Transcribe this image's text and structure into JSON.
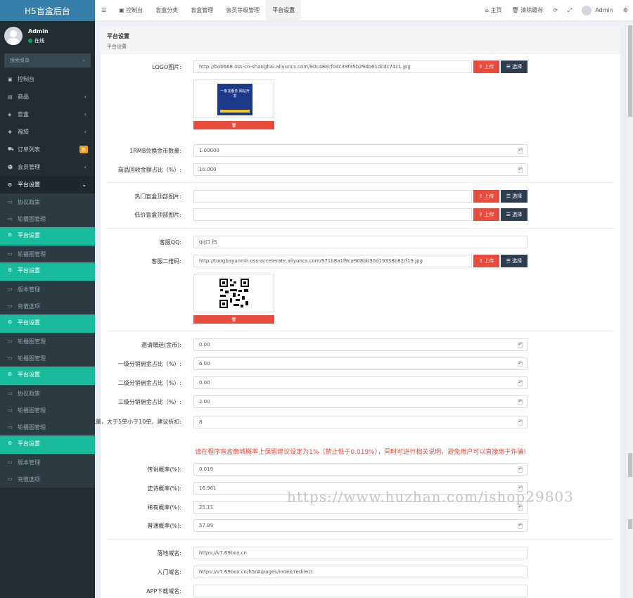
{
  "app": {
    "title": "H5盲盒后台"
  },
  "user": {
    "name": "Admin",
    "status": "在线"
  },
  "search": {
    "placeholder": "搜索菜单"
  },
  "sidebar": {
    "items": [
      {
        "label": "控制台",
        "icon": "dashboard-icon"
      },
      {
        "label": "商品",
        "icon": "box-icon",
        "arrow": "‹"
      },
      {
        "label": "盲盒",
        "icon": "cube-icon",
        "arrow": "‹"
      },
      {
        "label": "福袋",
        "icon": "gift-icon",
        "arrow": "‹"
      },
      {
        "label": "订单列表",
        "icon": "cart-icon",
        "badge": "新"
      },
      {
        "label": "会员管理",
        "icon": "users-icon",
        "arrow": "‹"
      },
      {
        "label": "平台设置",
        "icon": "gear-icon",
        "arrow": "⌄"
      }
    ],
    "sub": [
      {
        "label": "协议政策",
        "cls": ""
      },
      {
        "label": "轮播图管理",
        "cls": ""
      },
      {
        "label": "平台设置",
        "cls": "green"
      },
      {
        "label": "轮播图管理",
        "cls": ""
      },
      {
        "label": "平台设置",
        "cls": "green"
      },
      {
        "label": "版本管理",
        "cls": ""
      },
      {
        "label": "充值选项",
        "cls": ""
      },
      {
        "label": "平台设置",
        "cls": "green"
      },
      {
        "label": "轮播图管理",
        "cls": ""
      },
      {
        "label": "轮播图管理",
        "cls": ""
      },
      {
        "label": "平台设置",
        "cls": "green"
      },
      {
        "label": "协议政策",
        "cls": ""
      },
      {
        "label": "轮播图管理",
        "cls": ""
      },
      {
        "label": "轮播图管理",
        "cls": ""
      },
      {
        "label": "平台设置",
        "cls": "green"
      },
      {
        "label": "版本管理",
        "cls": ""
      },
      {
        "label": "充值选项",
        "cls": ""
      }
    ]
  },
  "topbar": {
    "menu_icon": "☰",
    "tabs": [
      "控制台",
      "盲盒分类",
      "盲盒管理",
      "会员等级管理",
      "平台设置"
    ],
    "home": "主页",
    "clear_cache": "清除缓存",
    "user": "Admin"
  },
  "panel": {
    "title": "平台设置",
    "subtitle": "平台设置"
  },
  "buttons": {
    "upload": "上传",
    "select": "选择",
    "delete": "🗑"
  },
  "logo_image": {
    "caption": "一条龙服务 网站开发"
  },
  "form": {
    "logo": {
      "label": "LOGO图片:",
      "value": "http://bob668.oss-cn-shanghai.aliyuncs.com/90c48ecf0dc39f35b294b61dcdc74c1.jpg"
    },
    "rmb_coin": {
      "label": "1RMB兑换金币数量:",
      "value": "1.00000"
    },
    "recycle_ratio": {
      "label": "商品回收金额占比（%）:",
      "value": "10.000"
    },
    "hot_top_image": {
      "label": "热门盲盒顶部图片:",
      "value": ""
    },
    "cheap_top_image": {
      "label": "低价盲盒顶部图片:",
      "value": ""
    },
    "service_qq": {
      "label": "客服QQ:",
      "value": "qq口 扫"
    },
    "service_qr": {
      "label": "客服二维码:",
      "value": "http://tongbayunmh.oss-accelerate.aliyuncs.com/971b8a1f9ca908bb30d19338b82/f19.jpg"
    },
    "invite_reward": {
      "label": "邀请赠送(金币):",
      "value": "0.00"
    },
    "level1_ratio": {
      "label": "一级分销佣金占比（%）:",
      "value": "6.00"
    },
    "level2_ratio": {
      "label": "二级分销佣金占比（%）:",
      "value": "0.00"
    },
    "level3_ratio": {
      "label": "三级分销佣金占比（%）:",
      "value": "2.00"
    },
    "bulk_discount": {
      "label": "批量，大于5单小于10单，建议折扣:",
      "value": "8"
    },
    "legend_prob": {
      "label": "传说概率(%):",
      "value": "0.019"
    },
    "epic_prob": {
      "label": "史诗概率(%):",
      "value": "16.981"
    },
    "rare_prob": {
      "label": "稀有概率(%):",
      "value": "25.11"
    },
    "common_prob": {
      "label": "普通概率(%):",
      "value": "57.89"
    },
    "bind_domain": {
      "label": "落地域名:",
      "value": "https://v7.69box.cn"
    },
    "entry_domain": {
      "label": "入门域名:",
      "value": "https://v7.69box.cn/h5/#/pages/index/redirect"
    },
    "app_download": {
      "label": "APP下载域名:",
      "value": ""
    }
  },
  "warning": "请在程序盲盒商城概率上保留建议设定为1%（禁止低于0.019%），同时可进行相关说明，避免用户可以直接用于诈骗!",
  "watermark": "https://www.huzhan.com/ishop29803",
  "colors": {
    "accent_green": "#18bc9c",
    "danger": "#e74c3c",
    "dark": "#2c3e50",
    "sidebar": "#222d32",
    "logo_bar": "#367fa9"
  }
}
